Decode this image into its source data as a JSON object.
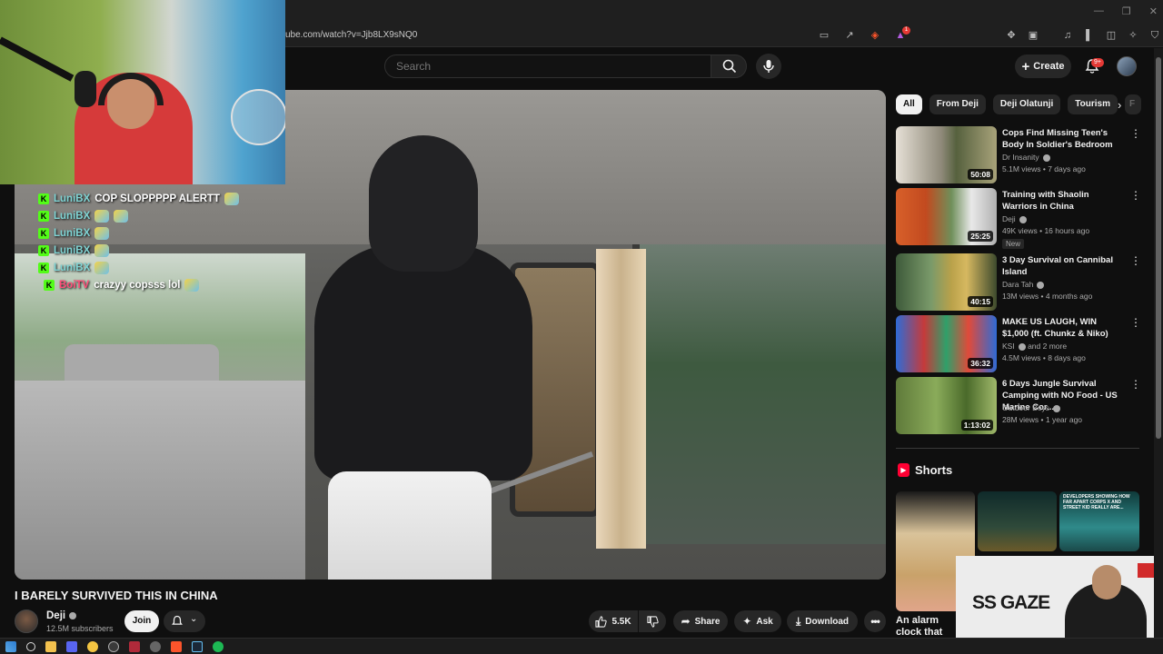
{
  "browser": {
    "url": "ube.com/watch?v=Jjb8LX9sNQ0",
    "ext_badge": "1"
  },
  "header": {
    "search_placeholder": "Search",
    "create_label": "Create",
    "notif_count": "9+"
  },
  "stream_chat": [
    {
      "user": "LuniBX",
      "text": "COP SLOPPPPP ALERTT",
      "emotes": 1,
      "user_color": "#7fd4d4"
    },
    {
      "user": "LuniBX",
      "text": "",
      "emotes": 2,
      "user_color": "#7fd4d4"
    },
    {
      "user": "LuniBX",
      "text": "",
      "emotes": 1,
      "user_color": "#7fd4d4"
    },
    {
      "user": "LuniBX",
      "text": "",
      "emotes": 1,
      "user_color": "#7fd4d4"
    },
    {
      "user": "LuniBX",
      "text": "",
      "emotes": 1,
      "user_color": "#7fd4d4"
    },
    {
      "user": "BoiTV",
      "text": "crazyy copsss lol",
      "emotes": 1,
      "user_color": "#ff4f7a"
    }
  ],
  "cam2": {
    "logo": "SS GAZE"
  },
  "video": {
    "title": "I BARELY SURVIVED THIS IN CHINA",
    "channel": "Deji",
    "subscribers": "12.5M subscribers",
    "join_label": "Join",
    "likes": "5.5K",
    "share_label": "Share",
    "ask_label": "Ask",
    "download_label": "Download"
  },
  "chips": [
    {
      "label": "All",
      "active": true
    },
    {
      "label": "From Deji",
      "active": false
    },
    {
      "label": "Deji Olatunji",
      "active": false
    },
    {
      "label": "Tourism",
      "active": false
    },
    {
      "label": "F",
      "active": false
    }
  ],
  "recommendations": [
    {
      "title": "Cops Find Missing Teen's Body In Soldier's Bedroom",
      "channel": "Dr Insanity",
      "meta": "5.1M views • 7 days ago",
      "duration": "50:08",
      "badge": ""
    },
    {
      "title": "Training with Shaolin Warriors in China",
      "channel": "Deji",
      "meta": "49K views • 16 hours ago",
      "duration": "25:25",
      "badge": "New"
    },
    {
      "title": "3 Day Survival on Cannibal Island",
      "channel": "Dara Tah",
      "meta": "13M views • 4 months ago",
      "duration": "40:15",
      "badge": ""
    },
    {
      "title": "MAKE US LAUGH, WIN $1,000 (ft. Chunkz & Niko)",
      "channel": "KSI",
      "channel_extra": "and 2 more",
      "meta": "4.5M views • 8 days ago",
      "duration": "36:32",
      "badge": ""
    },
    {
      "title": "6 Days Jungle Survival Camping with NO Food - US Marine Cor...",
      "channel": "Outdoor Boys",
      "meta": "28M views • 1 year ago",
      "duration": "1:13:02",
      "badge": ""
    }
  ],
  "shorts": {
    "heading": "Shorts",
    "first_title": "An alarm clock that",
    "third_overlay": "DEVELOPERS SHOWING HOW FAR APART CORPS X AND STREET KID REALLY ARE..."
  },
  "colors": {
    "bg": "#0f0f0f",
    "chip_bg": "#272727",
    "accent_red": "#ff0033",
    "kick_green": "#53fc18"
  }
}
